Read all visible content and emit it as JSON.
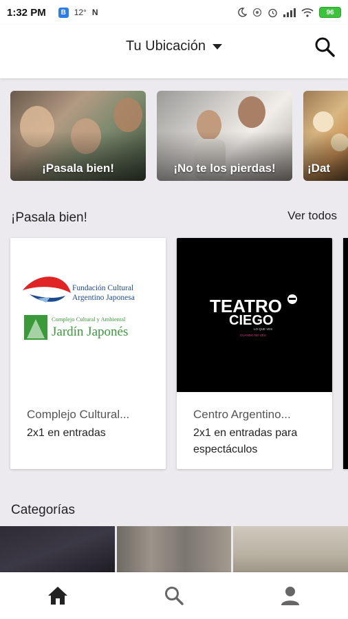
{
  "status_bar": {
    "time": "1:32 PM",
    "temp": "12°",
    "battery": "96",
    "icons": [
      "notification-b-icon",
      "n-icon",
      "moon-icon",
      "location-icon",
      "alarm-icon",
      "signal-icon",
      "wifi-icon",
      "battery-icon"
    ]
  },
  "header": {
    "location_label": "Tu Ubicación",
    "icons": [
      "caret-down-icon",
      "search-icon"
    ]
  },
  "banners": [
    {
      "label": "¡Pasala bien!"
    },
    {
      "label": "¡No te los pierdas!"
    },
    {
      "label": "¡Dat"
    }
  ],
  "section": {
    "title": "¡Pasala bien!",
    "see_all": "Ver todos"
  },
  "cards": [
    {
      "name": "Complejo Cultural...",
      "offer": "2x1 en entradas",
      "logo_text_1": "Fundación Cultural",
      "logo_text_2": "Argentino Japonesa",
      "logo_text_3": "Complejo Cultural y Ambiental",
      "logo_text_4": "Jardín Japonés"
    },
    {
      "name": "Centro Argentino...",
      "offer": "2x1 en entradas para espectáculos",
      "logo_text_1": "TEATRO",
      "logo_text_2": "CIEGO",
      "logo_text_3": "LO QUE VES",
      "logo_text_4": "CUANDO NO VES"
    }
  ],
  "categories": {
    "title": "Categorías"
  },
  "bottom_nav": {
    "icons": [
      "home-icon",
      "search-icon",
      "profile-icon"
    ]
  },
  "colors": {
    "background": "#eceaee",
    "logo_red": "#e02424",
    "logo_blue": "#1d4b8f",
    "logo_green": "#3a9a3a"
  }
}
